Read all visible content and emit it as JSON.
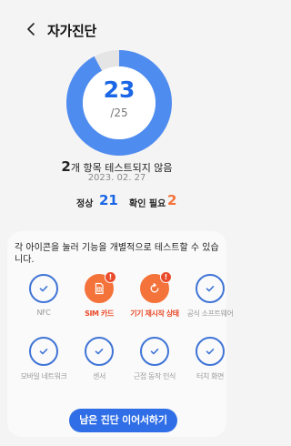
{
  "header": {
    "title": "자가진단"
  },
  "score": {
    "value": "23",
    "total": "/25",
    "fraction": 0.92
  },
  "summary": {
    "count": "2",
    "text": "개 항목 테스트되지 않음",
    "date": "2023. 02. 27"
  },
  "counts": {
    "normal_label": "정상",
    "normal_value": "21",
    "check_label": "확인 필요",
    "check_value": "2"
  },
  "colors": {
    "accent": "#1a66e6",
    "warning": "#f4733a",
    "ring": "#4f8cf0",
    "ring_bg": "#e5e5e5"
  },
  "panel": {
    "description": "각 아이콘을 눌러 기능을 개별적으로 테스트할 수 있습니다.",
    "items": [
      {
        "label": "NFC",
        "icon": "check-icon",
        "status": "ok"
      },
      {
        "label": "SIM 카드",
        "icon": "sim-card-icon",
        "status": "warning"
      },
      {
        "label": "기기 재시작 상태",
        "icon": "restart-icon",
        "status": "warning"
      },
      {
        "label": "공식 소프트웨어",
        "icon": "check-icon",
        "status": "ok"
      },
      {
        "label": "모바일 네트워크",
        "icon": "check-icon",
        "status": "ok"
      },
      {
        "label": "센서",
        "icon": "check-icon",
        "status": "ok"
      },
      {
        "label": "근접 동작 인식",
        "icon": "check-icon",
        "status": "ok"
      },
      {
        "label": "터치 화면",
        "icon": "check-icon",
        "status": "ok"
      }
    ]
  },
  "cta": {
    "label": "남은 진단 이어서하기"
  }
}
